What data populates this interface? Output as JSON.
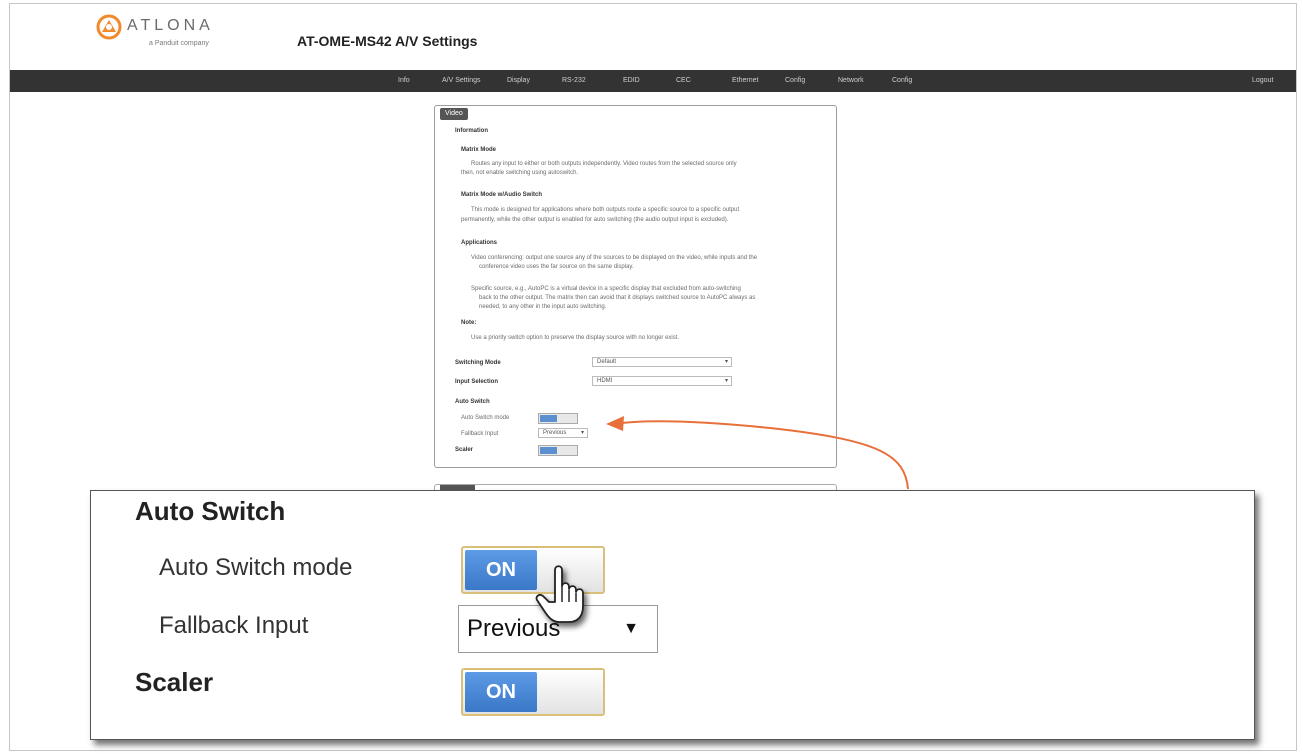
{
  "header": {
    "brand": "ATLONA",
    "brand_sub": "a Panduit company",
    "title": "AT-OME-MS42  A/V Settings"
  },
  "navbar": {
    "items": [
      "Info",
      "A/V Settings",
      "Display",
      "RS-232",
      "EDID",
      "CEC",
      "Ethernet",
      "Config",
      "Network",
      "Config"
    ],
    "logout": "Logout"
  },
  "video_panel": {
    "tab": "Video",
    "information": "Information",
    "matrix_mode_title": "Matrix Mode",
    "matrix_mode_text_1": "Routes any input to either or both outputs independently. Video routes from the selected source only",
    "matrix_mode_text_2": "then, not enable switching using autoswitch.",
    "matrix_sub_title": "Matrix Mode w/Audio Switch",
    "matrix_sub_text_1": "This mode is designed for applications where both outputs route a specific source to a specific output",
    "matrix_sub_text_2": "permanently, while the other output is enabled for auto switching (the audio output input is excluded).",
    "applications": "Applications",
    "app_1a": "Video conferencing: output one source any of the sources to be displayed on the video, while inputs and the",
    "app_1b": "conference video uses the far source on the same display.",
    "app_2a": "Specific source, e.g., AutoPC is a virtual device in a specific display that excluded from auto-switching",
    "app_2b": "back to the other output. The matrix then can avoid that it displays switched source to AutoPC always as",
    "app_2c": "needed, to any other in the input auto switching.",
    "note_title": "Note:",
    "note_text": "Use a priority switch option to preserve the display source with no longer exist.",
    "switching_mode_label": "Switching Mode",
    "switching_mode_value": "Default",
    "input_selection_label": "Input Selection",
    "input_selection_value": "HDMI",
    "auto_switch_label": "Auto Switch",
    "auto_switch_mode_label": "Auto Switch mode",
    "fallback_input_label": "Fallback Input",
    "fallback_input_value": "Previous",
    "scaler_label": "Scaler",
    "on": "ON"
  },
  "zoom": {
    "auto_switch_heading": "Auto Switch",
    "auto_switch_mode_label": "Auto Switch mode",
    "auto_switch_mode_state": "ON",
    "fallback_input_label": "Fallback Input",
    "fallback_input_value": "Previous",
    "scaler_label": "Scaler",
    "scaler_state": "ON"
  },
  "colors": {
    "navbar_bg": "#333333",
    "toggle_on": "#3a78c8",
    "callout_arrow": "#e8703a"
  }
}
